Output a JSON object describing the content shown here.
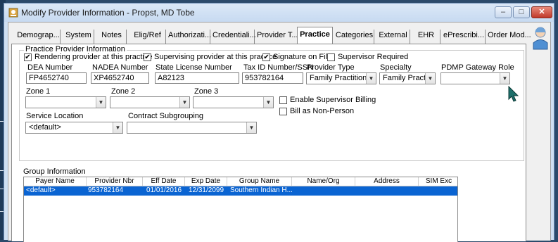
{
  "window": {
    "title": "Modify Provider Information - Propst, MD Tobe",
    "controls": {
      "minimize": "–",
      "maximize": "□",
      "close": "✕"
    }
  },
  "tabs": [
    {
      "label": "Demograp...",
      "active": false
    },
    {
      "label": "System",
      "active": false
    },
    {
      "label": "Notes",
      "active": false
    },
    {
      "label": "Elig/Ref",
      "active": false
    },
    {
      "label": "Authorizati...",
      "active": false
    },
    {
      "label": "Credentiali...",
      "active": false
    },
    {
      "label": "Provider T...",
      "active": false
    },
    {
      "label": "Practice",
      "active": true
    },
    {
      "label": "Categories",
      "active": false
    },
    {
      "label": "External",
      "active": false
    },
    {
      "label": "EHR",
      "active": false
    },
    {
      "label": "ePrescribi...",
      "active": false
    },
    {
      "label": "Order Mod...",
      "active": false
    }
  ],
  "practice": {
    "group_title": "Practice Provider Information",
    "checkboxes": {
      "rendering": {
        "label": "Rendering provider at this practice",
        "checked": true
      },
      "supervising": {
        "label": "Supervising provider at this practice",
        "checked": true
      },
      "signature": {
        "label": "Signature on File",
        "checked": true
      },
      "supervisor_required": {
        "label": "Supervisor Required",
        "checked": false
      },
      "enable_supervisor_billing": {
        "label": "Enable Supervisor Billing",
        "checked": false
      },
      "bill_non_person": {
        "label": "Bill as Non-Person",
        "checked": false
      }
    },
    "fields": {
      "dea": {
        "label": "DEA Number",
        "value": "FP4652740"
      },
      "nadea": {
        "label": "NADEA Number",
        "value": "XP4652740"
      },
      "state_license": {
        "label": "State License Number",
        "value": "A82123"
      },
      "tax_id": {
        "label": "Tax ID Number/SSN",
        "value": "953782164"
      },
      "provider_type": {
        "label": "Provider Type",
        "value": "Family Practitione"
      },
      "specialty": {
        "label": "Specialty",
        "value": "Family Pract"
      },
      "pdmp": {
        "label": "PDMP Gateway Role",
        "value": ""
      },
      "zone1": {
        "label": "Zone 1",
        "value": ""
      },
      "zone2": {
        "label": "Zone 2",
        "value": ""
      },
      "zone3": {
        "label": "Zone 3",
        "value": ""
      },
      "service_location": {
        "label": "Service Location",
        "value": "<default>"
      },
      "contract_subgrouping": {
        "label": "Contract Subgrouping",
        "value": ""
      }
    }
  },
  "group_info": {
    "label": "Group Information",
    "columns": [
      "Payer Name",
      "Provider Nbr",
      "Eff Date",
      "Exp Date",
      "Group Name",
      "Name/Org",
      "Address",
      "SIM Exc"
    ],
    "rows": [
      [
        "<default>",
        "953782164",
        "01/01/2016",
        "12/31/2099",
        "Southern Indian H...",
        "",
        "",
        ""
      ]
    ]
  },
  "colors": {
    "selection": "#0a64d2",
    "window_frame": "#cfe0f3",
    "close_button": "#c0392b"
  },
  "icons": {
    "app": "provider-app-icon",
    "user": "user-profile-icon",
    "cursor": "mouse-pointer-icon"
  }
}
